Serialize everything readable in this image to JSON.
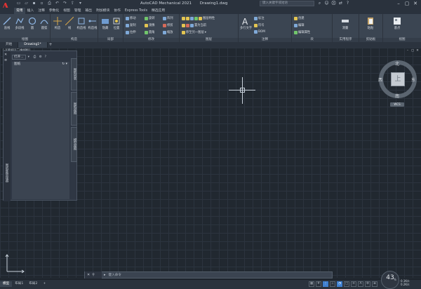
{
  "app": {
    "title": "AutoCAD Mechanical 2021",
    "file": "Drawing1.dwg",
    "search_placeholder": "键入关键字或短语"
  },
  "ribbon_tabs": [
    "常用",
    "插入",
    "注释",
    "参数化",
    "视图",
    "管理",
    "输出",
    "附加模块",
    "协作",
    "Express Tools",
    "精选应用"
  ],
  "active_ribbon_tab": 0,
  "ribbon": {
    "groups": [
      {
        "label": "绘图",
        "big": [
          "直线",
          "多段线",
          "圆",
          "圆弧"
        ]
      },
      {
        "label": "构造",
        "big": [
          "构造",
          "线",
          "构造线",
          "构造线"
        ]
      },
      {
        "label": "局部",
        "big": [
          "隐藏",
          "位置"
        ]
      },
      {
        "label": "修改",
        "small": [
          "移动",
          "旋转",
          "修剪",
          "复制",
          "镜像",
          "圆角",
          "拉伸",
          "缩放",
          "阵列"
        ]
      },
      {
        "label": "图层",
        "small": [
          "图层特性",
          "置为当前",
          "匹配图层"
        ]
      },
      {
        "label": "注释",
        "big": [
          "多行文字"
        ],
        "small": [
          "标注",
          "符号",
          "BOM"
        ]
      },
      {
        "label": "块",
        "small": [
          "创建",
          "编辑",
          "编辑属性"
        ]
      },
      {
        "label": "实用程序",
        "big": [
          "测量"
        ]
      },
      {
        "label": "剪贴板",
        "big": [
          "粘贴"
        ]
      },
      {
        "label": "视图",
        "big": [
          "基点"
        ]
      }
    ],
    "layer_value": "移至另一图层"
  },
  "file_tabs": [
    "开始",
    "Drawing1*"
  ],
  "active_file_tab": 1,
  "viewport_label": "[-][俯视][二维线框]",
  "left_panel": {
    "open_label": "打开...",
    "tree_header": "图纸",
    "side_title": "图纸集管理器",
    "vtabs": [
      "图纸列表",
      "图纸视图",
      "模型视图"
    ]
  },
  "viewcube": {
    "north": "北",
    "south": "南",
    "east": "东",
    "west": "西",
    "face": "上",
    "wcs": "WCS"
  },
  "command_line": {
    "placeholder": "键入命令"
  },
  "layout_tabs": [
    "模型",
    "布局1",
    "布局2"
  ],
  "active_layout_tab": 0,
  "status": {
    "perf_value": "43",
    "perf_unit": "%",
    "net_up": "0.1K/s",
    "net_down": "0.2K/s"
  }
}
